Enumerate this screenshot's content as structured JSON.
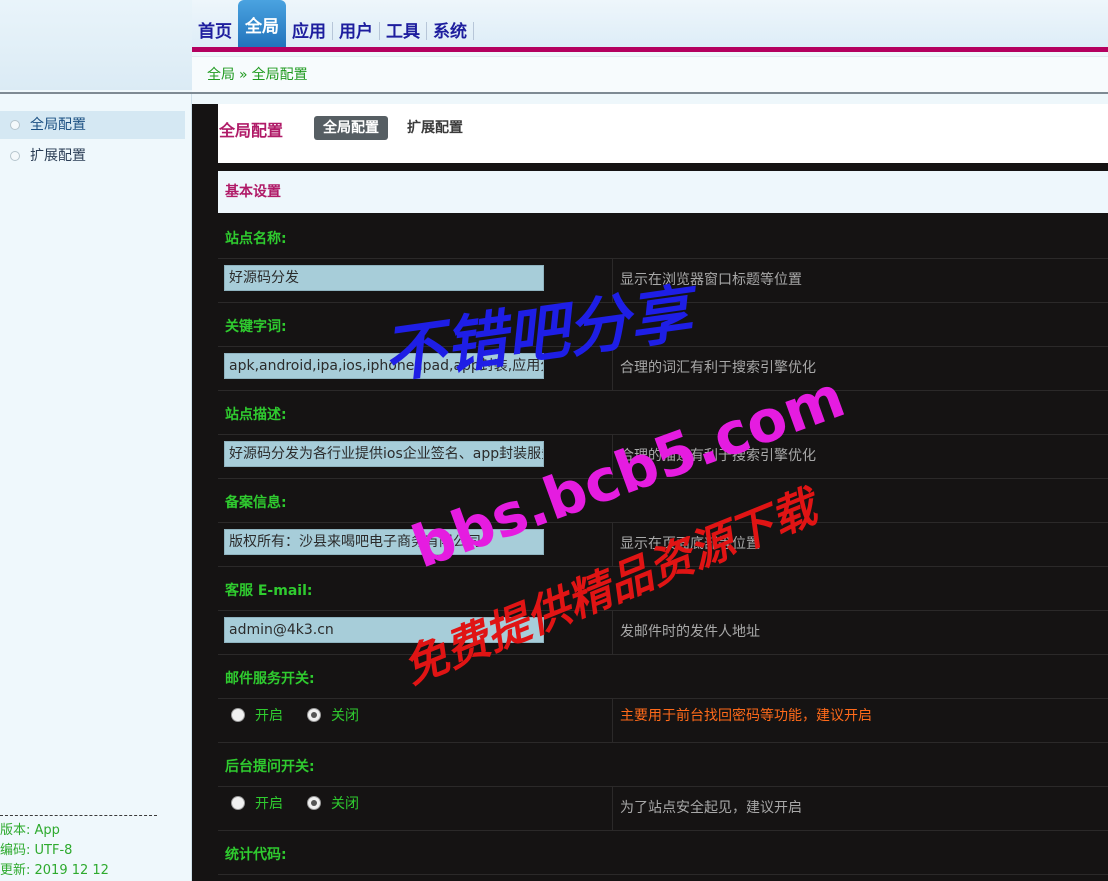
{
  "nav": {
    "items": [
      {
        "label": "首页",
        "active": false
      },
      {
        "label": "全局",
        "active": true
      },
      {
        "label": "应用",
        "active": false
      },
      {
        "label": "用户",
        "active": false
      },
      {
        "label": "工具",
        "active": false
      },
      {
        "label": "系统",
        "active": false
      }
    ]
  },
  "breadcrumb": {
    "root": "全局",
    "separator": "»",
    "current": "全局配置"
  },
  "sidebar": {
    "items": [
      {
        "label": "全局配置",
        "active": true
      },
      {
        "label": "扩展配置",
        "active": false
      }
    ],
    "info": {
      "version": "版本: App",
      "encoding": "编码: UTF-8",
      "updated": "更新: 2019 12 12"
    }
  },
  "tabs": {
    "title": "全局配置",
    "items": [
      {
        "label": "全局配置",
        "active": true
      },
      {
        "label": "扩展配置",
        "active": false
      }
    ]
  },
  "section": {
    "title": "基本设置"
  },
  "fields": {
    "site_name": {
      "label": "站点名称:",
      "value": "好源码分发",
      "hint": "显示在浏览器窗口标题等位置"
    },
    "keywords": {
      "label": "关键字词:",
      "value": "apk,android,ipa,ios,iphone,ipad,app封装,应用分发",
      "hint": "合理的词汇有利于搜索引擎优化"
    },
    "description": {
      "label": "站点描述:",
      "value": "好源码分发为各行业提供ios企业签名、app封装服务",
      "hint": "合理的描述有利于搜索引擎优化"
    },
    "icp": {
      "label": "备案信息:",
      "value": "版权所有：沙县来喝吧电子商务有限公司",
      "hint": "显示在页面底部等位置"
    },
    "email": {
      "label": "客服 E-mail:",
      "value": "admin@4k3.cn",
      "hint": "发邮件时的发件人地址"
    },
    "mail_switch": {
      "label": "邮件服务开关:",
      "on_label": "开启",
      "off_label": "关闭",
      "selected": "off",
      "hint": "主要用于前台找回密码等功能，建议开启"
    },
    "admin_question": {
      "label": "后台提问开关:",
      "on_label": "开启",
      "off_label": "关闭",
      "selected": "off",
      "hint": "为了站点安全起见，建议开启"
    },
    "stats_code": {
      "label": "统计代码:"
    }
  },
  "watermark": {
    "line1": "不错吧分享",
    "line2": "bbs.bcb5.com",
    "line3": "免费提供精品资源下载"
  },
  "colors": {
    "accent": "#b4005f",
    "label_green": "#2fcb2f",
    "nav_active": "#1e6fb8",
    "warn": "#ff6a1a",
    "watermark_blue": "#1e1ee6",
    "watermark_magenta": "#e51ce0",
    "watermark_red": "#e01414"
  }
}
